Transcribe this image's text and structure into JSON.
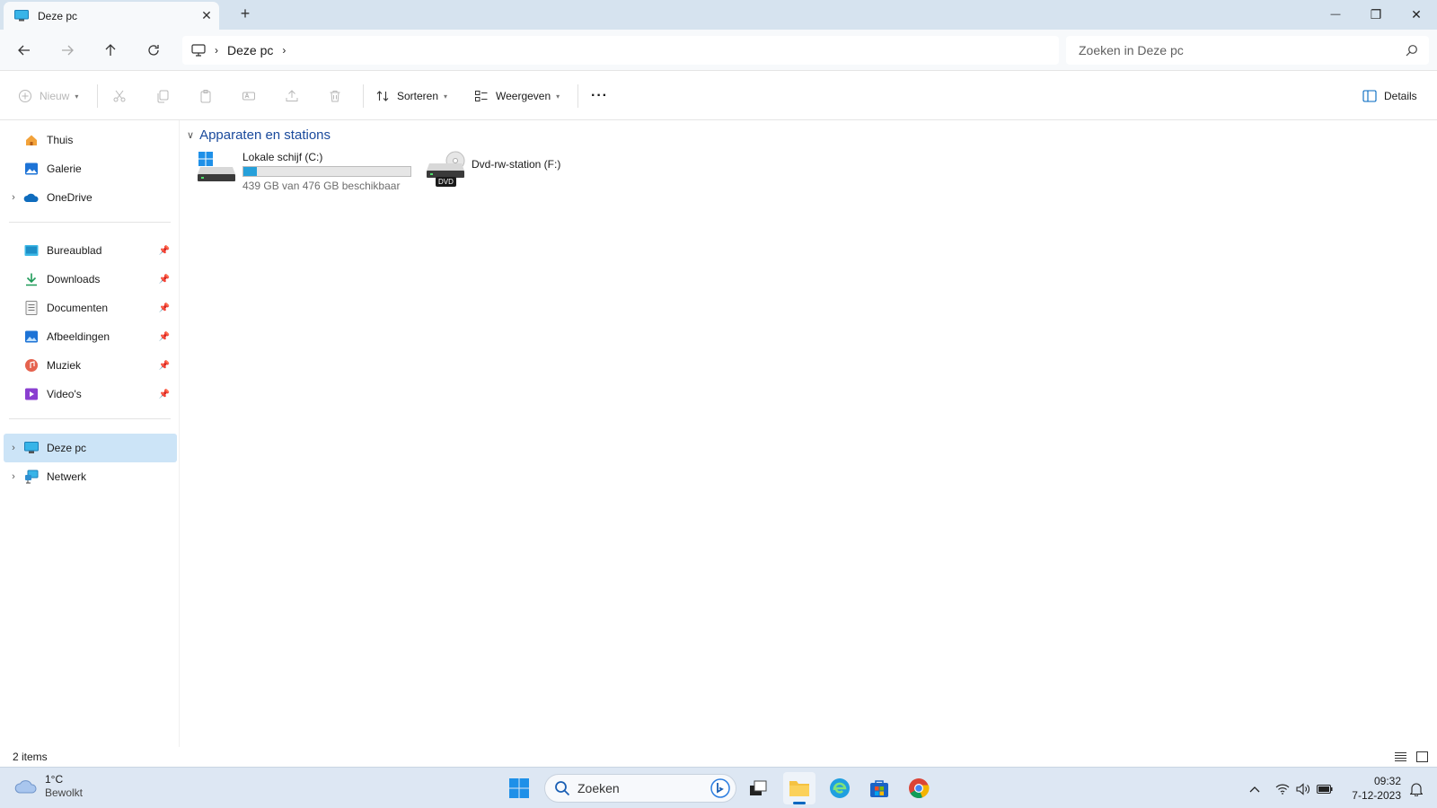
{
  "window": {
    "tab_title": "Deze pc",
    "new_tab_symbol": "+",
    "close_tab_symbol": "✕",
    "minimize_symbol": "—",
    "maximize_symbol": "❐",
    "close_symbol": "✕"
  },
  "address": {
    "breadcrumb_location": "Deze pc",
    "search_placeholder": "Zoeken in Deze pc"
  },
  "commands": {
    "new_label": "Nieuw",
    "sort_label": "Sorteren",
    "view_label": "Weergeven",
    "more_label": "···",
    "details_label": "Details"
  },
  "sidebar": {
    "quick": [
      {
        "label": "Thuis",
        "icon": "home-icon"
      },
      {
        "label": "Galerie",
        "icon": "gallery-icon"
      },
      {
        "label": "OneDrive",
        "icon": "onedrive-icon"
      }
    ],
    "pinned": [
      {
        "label": "Bureaublad",
        "icon": "desktop-folder-icon"
      },
      {
        "label": "Downloads",
        "icon": "downloads-icon"
      },
      {
        "label": "Documenten",
        "icon": "documents-icon"
      },
      {
        "label": "Afbeeldingen",
        "icon": "pictures-icon"
      },
      {
        "label": "Muziek",
        "icon": "music-icon"
      },
      {
        "label": "Video's",
        "icon": "videos-icon"
      }
    ],
    "locations": [
      {
        "label": "Deze pc",
        "icon": "this-pc-icon",
        "selected": true
      },
      {
        "label": "Netwerk",
        "icon": "network-icon"
      }
    ]
  },
  "content": {
    "group_title": "Apparaten en stations",
    "drives": [
      {
        "name": "Lokale schijf (C:)",
        "free_text": "439 GB van 476 GB beschikbaar",
        "used_fraction": 0.078
      },
      {
        "name": "Dvd-rw-station (F:)",
        "badge": "DVD"
      }
    ]
  },
  "status": {
    "item_count": "2 items"
  },
  "taskbar": {
    "temperature": "1°C",
    "weather": "Bewolkt",
    "search_label": "Zoeken",
    "time": "09:32",
    "date": "7-12-2023"
  },
  "colors": {
    "accent": "#0067c0",
    "selection": "#cce4f7",
    "drive_bar": "#26a0da",
    "titlebar": "#d6e3ef",
    "taskbar": "#dde7f3"
  }
}
